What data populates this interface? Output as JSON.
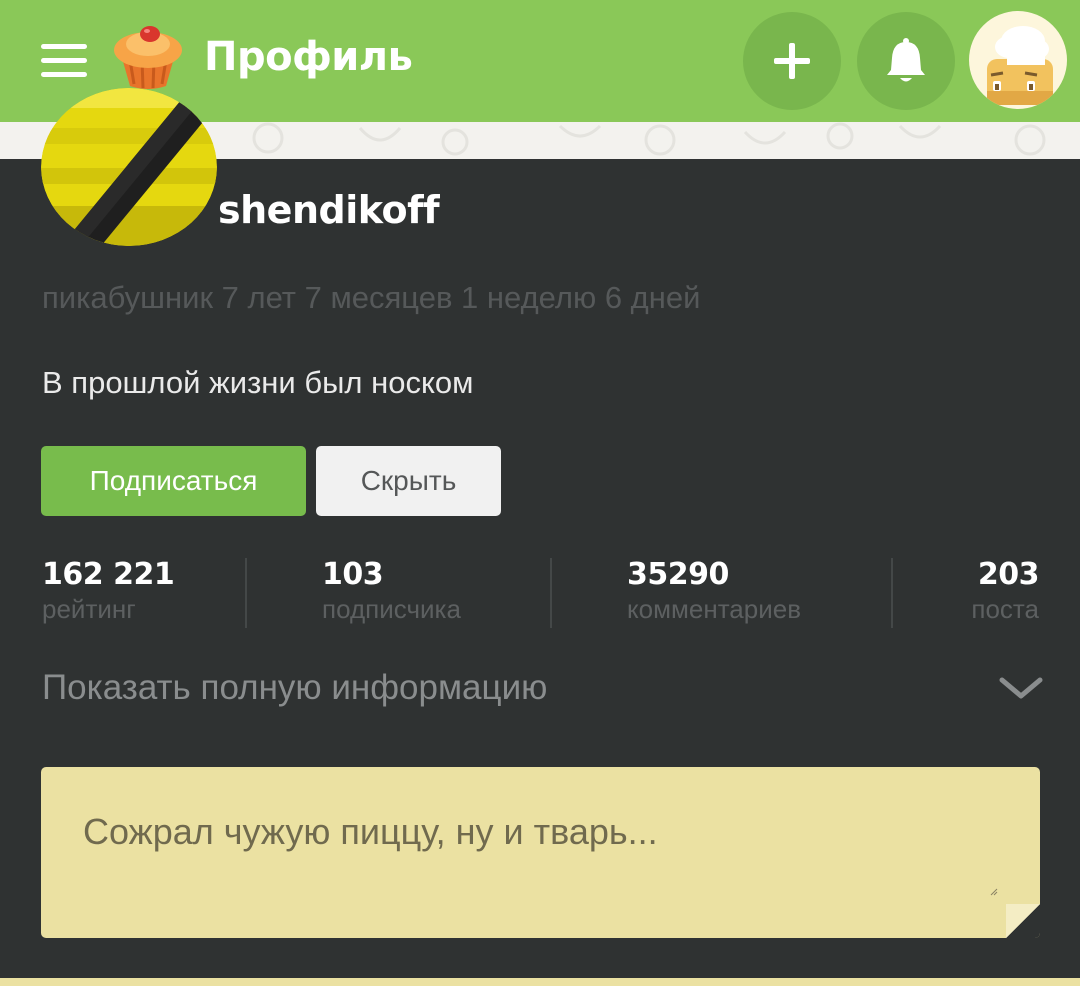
{
  "header": {
    "title": "Профиль",
    "menu_icon": "hamburger-icon",
    "logo_icon": "cupcake-logo-icon",
    "add_icon": "plus-icon",
    "notification_icon": "bell-icon",
    "user_avatar": "chef-avatar-icon",
    "background_color": "#8ac858"
  },
  "profile": {
    "username": "shendikoff",
    "tenure": "пикабушник 7 лет 7 месяцев 1 неделю 6 дней",
    "bio": "В прошлой жизни был носком",
    "avatar_icon": "yellow-black-stripe-avatar",
    "subscribe_label": "Подписаться",
    "hide_label": "Скрыть"
  },
  "stats": [
    {
      "value": "162 221",
      "label": "рейтинг"
    },
    {
      "value": "103",
      "label": "подписчика"
    },
    {
      "value": "35290",
      "label": "комментариев"
    },
    {
      "value": "203",
      "label": "поста"
    }
  ],
  "show_more_label": "Показать полную информацию",
  "note": {
    "placeholder": "Сожрал чужую пиццу, ну и тварь..."
  },
  "colors": {
    "accent": "#78bc4c",
    "background": "#2f3232",
    "note": "#ebe1a2"
  }
}
